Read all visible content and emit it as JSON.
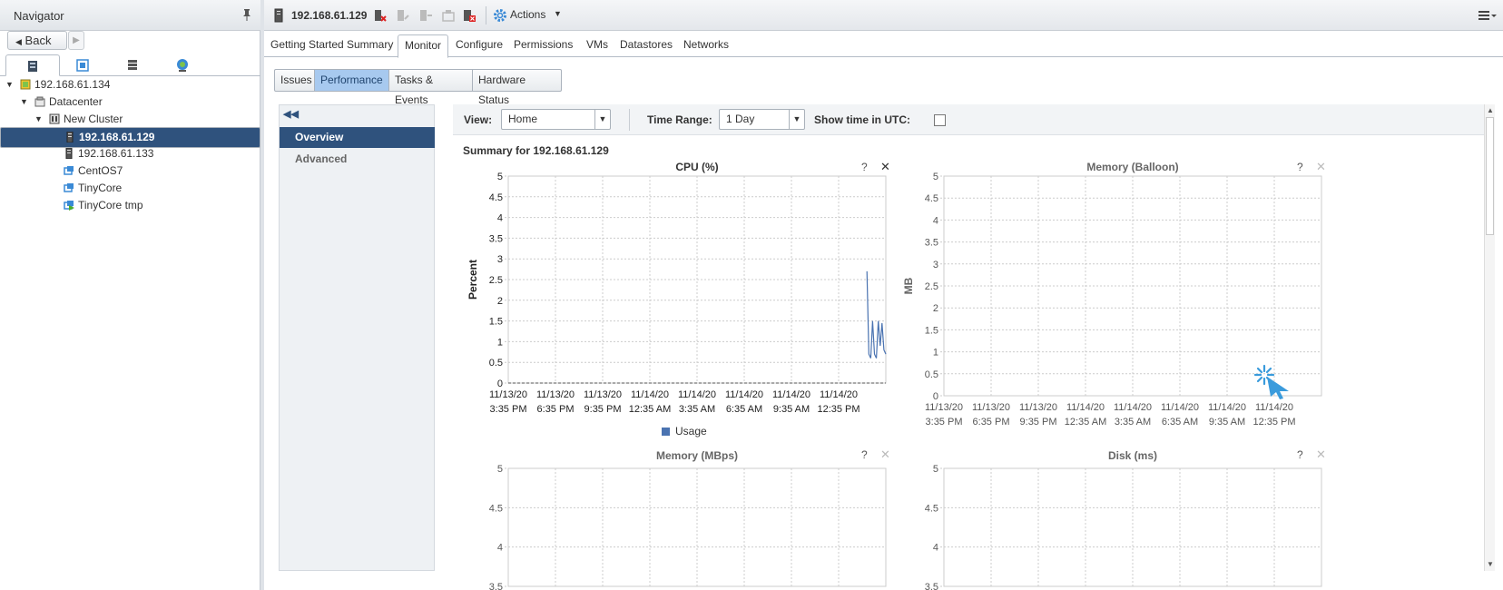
{
  "navigator": {
    "title": "Navigator",
    "back_label": "Back",
    "tree": [
      {
        "label": "192.168.61.134",
        "icon": "vcenter-icon",
        "level": 0,
        "expanded": true
      },
      {
        "label": "Datacenter",
        "icon": "datacenter-icon",
        "level": 1,
        "expanded": true
      },
      {
        "label": "New Cluster",
        "icon": "cluster-icon",
        "level": 2,
        "expanded": true
      },
      {
        "label": "192.168.61.129",
        "icon": "host-icon",
        "level": 3,
        "selected": true
      },
      {
        "label": "192.168.61.133",
        "icon": "host-icon",
        "level": 3
      },
      {
        "label": "CentOS7",
        "icon": "vm-icon",
        "level": 3
      },
      {
        "label": "TinyCore",
        "icon": "vm-icon",
        "level": 3
      },
      {
        "label": "TinyCore tmp",
        "icon": "vm-running-icon",
        "level": 3
      }
    ]
  },
  "header": {
    "host_title": "192.168.61.129",
    "actions_label": "Actions"
  },
  "main_tabs": [
    "Getting Started",
    "Summary",
    "Monitor",
    "Configure",
    "Permissions",
    "VMs",
    "Datastores",
    "Networks"
  ],
  "active_main_tab": "Monitor",
  "sub_tabs": [
    "Issues",
    "Performance",
    "Tasks & Events",
    "Hardware Status"
  ],
  "active_sub_tab": "Performance",
  "perf_nav": {
    "overview": "Overview",
    "advanced": "Advanced"
  },
  "toolbar": {
    "view_label": "View:",
    "view_value": "Home",
    "time_range_label": "Time Range:",
    "time_range_value": "1 Day",
    "utc_label": "Show time in UTC:"
  },
  "summary_title": "Summary for 192.168.61.129",
  "colors": {
    "accent": "#2f527d",
    "series": "#4a73b1",
    "loading": "#3a9bdc"
  },
  "chart_data": [
    {
      "type": "line",
      "title": "CPU (%)",
      "ylabel": "Percent",
      "ylim": [
        0,
        5
      ],
      "yticks": [
        "0",
        "0.5",
        "1",
        "1.5",
        "2",
        "2.5",
        "3",
        "3.5",
        "4",
        "4.5",
        "5"
      ],
      "xticks": [
        [
          "11/13/20",
          "3:35 PM"
        ],
        [
          "11/13/20",
          "6:35 PM"
        ],
        [
          "11/13/20",
          "9:35 PM"
        ],
        [
          "11/14/20",
          "12:35 AM"
        ],
        [
          "11/14/20",
          "3:35 AM"
        ],
        [
          "11/14/20",
          "6:35 AM"
        ],
        [
          "11/14/20",
          "9:35 AM"
        ],
        [
          "11/14/20",
          "12:35 PM"
        ]
      ],
      "grid": true,
      "legend": "bottom",
      "series": [
        {
          "name": "Usage",
          "x": [
            7.6,
            7.64,
            7.68,
            7.72,
            7.76,
            7.8,
            7.84,
            7.88,
            7.92,
            7.96,
            8.0
          ],
          "values": [
            2.7,
            0.7,
            0.6,
            1.5,
            0.7,
            0.6,
            1.5,
            0.9,
            1.45,
            0.8,
            0.7
          ]
        }
      ]
    },
    {
      "type": "line",
      "title": "Memory (Balloon)",
      "ylabel": "MB",
      "ylim": [
        0,
        5
      ],
      "yticks": [
        "0",
        "0.5",
        "1",
        "1.5",
        "2",
        "2.5",
        "3",
        "3.5",
        "4",
        "4.5",
        "5"
      ],
      "xticks": [
        [
          "11/13/20",
          "3:35 PM"
        ],
        [
          "11/13/20",
          "6:35 PM"
        ],
        [
          "11/13/20",
          "9:35 PM"
        ],
        [
          "11/14/20",
          "12:35 AM"
        ],
        [
          "11/14/20",
          "3:35 AM"
        ],
        [
          "11/14/20",
          "6:35 AM"
        ],
        [
          "11/14/20",
          "9:35 AM"
        ],
        [
          "11/14/20",
          "12:35 PM"
        ]
      ],
      "grid": true,
      "series": []
    },
    {
      "type": "line",
      "title": "Memory (MBps)",
      "ylim": [
        3.5,
        5
      ],
      "yticks": [
        "3.5",
        "4",
        "4.5",
        "5"
      ],
      "grid": true,
      "series": []
    },
    {
      "type": "line",
      "title": "Disk (ms)",
      "ylim": [
        3.5,
        5
      ],
      "yticks": [
        "3.5",
        "4",
        "4.5",
        "5"
      ],
      "grid": true,
      "series": []
    }
  ]
}
